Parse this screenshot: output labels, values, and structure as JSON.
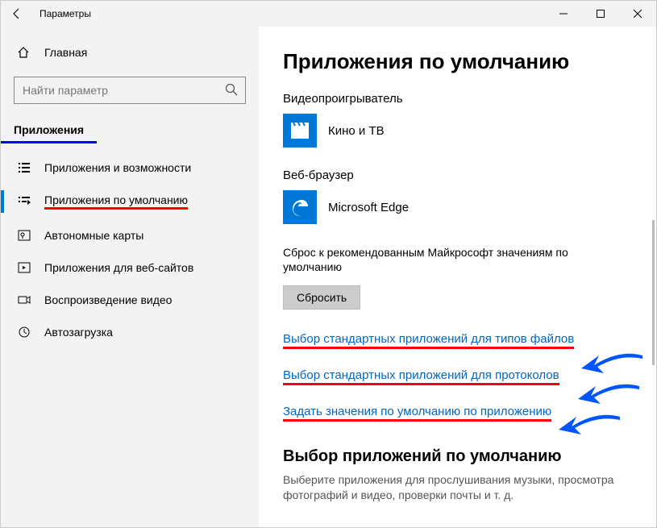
{
  "titlebar": {
    "title": "Параметры"
  },
  "sidebar": {
    "home": "Главная",
    "search_placeholder": "Найти параметр",
    "section": "Приложения",
    "items": [
      {
        "label": "Приложения и возможности"
      },
      {
        "label": "Приложения по умолчанию"
      },
      {
        "label": "Автономные карты"
      },
      {
        "label": "Приложения для веб-сайтов"
      },
      {
        "label": "Воспроизведение видео"
      },
      {
        "label": "Автозагрузка"
      }
    ]
  },
  "main": {
    "title": "Приложения по умолчанию",
    "video_label": "Видеопроигрыватель",
    "video_app": "Кино и ТВ",
    "browser_label": "Веб-браузер",
    "browser_app": "Microsoft Edge",
    "reset_desc": "Сброс к рекомендованным Майкрософт значениям по умолчанию",
    "reset_button": "Сбросить",
    "links": [
      "Выбор стандартных приложений для типов файлов",
      "Выбор стандартных приложений для протоколов",
      "Задать значения по умолчанию по приложению"
    ],
    "section2_title": "Выбор приложений по умолчанию",
    "section2_desc": "Выберите приложения для прослушивания музыки, просмотра фотографий и видео, проверки почты и т. д."
  }
}
